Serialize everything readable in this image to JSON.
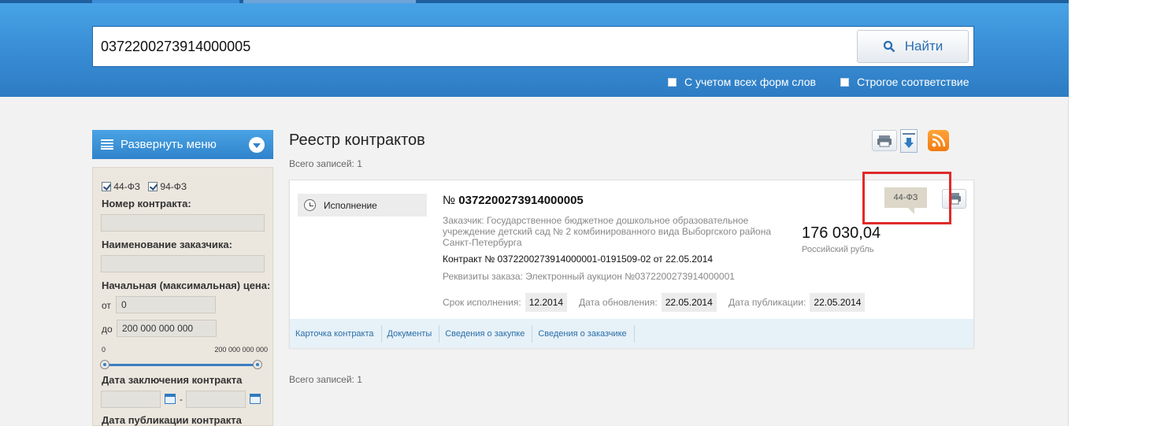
{
  "search": {
    "query": "0372200273914000005",
    "button_label": "Найти",
    "option_all_forms": "С учетом всех форм слов",
    "option_strict": "Строгое соответствие"
  },
  "sidebar": {
    "menu_label": "Развернуть меню",
    "law_44": "44-ФЗ",
    "law_94": "94-ФЗ",
    "contract_number_label": "Номер контракта:",
    "customer_name_label": "Наименование заказчика:",
    "price_label": "Начальная (максимальная) цена:",
    "from_label": "от",
    "from_value": "0",
    "to_label": "до",
    "to_value": "200 000 000 000",
    "slider_min": "0",
    "slider_max": "200 000 000 000",
    "conclusion_date_label": "Дата заключения контракта",
    "date_separator": "-",
    "publication_date_label": "Дата публикации контракта"
  },
  "main": {
    "title": "Реестр контрактов",
    "total_top": "Всего записей: 1",
    "total_bottom": "Всего записей: 1"
  },
  "contract": {
    "status": "Исполнение",
    "number_prefix": "№",
    "number": "0372200273914000005",
    "customer_line1": "Заказчик: Государственное бюджетное дошкольное образовательное",
    "customer_line2": "учреждение детский сад № 2 комбинированного вида Выборгского района",
    "customer_line3": "Санкт-Петербурга",
    "contract_line": "Контракт № 0372200273914000001-0191509-02 от 22.05.2014",
    "order_details": "Реквизиты заказа: Электронный аукцион №0372200273914000001",
    "price": "176 030,04",
    "currency": "Российский рубль",
    "law_tag": "44-ФЗ",
    "exec_label": "Срок исполнения:",
    "exec_value": "12.2014",
    "update_label": "Дата обновления:",
    "update_value": "22.05.2014",
    "pub_label": "Дата публикации:",
    "pub_value": "22.05.2014",
    "links": [
      "Карточка контракта",
      "Документы",
      "Сведения о закупке",
      "Сведения о заказчике"
    ]
  },
  "colors": {
    "banner": "#3a8fd6",
    "highlight": "#e02a2a",
    "link": "#2c6ea8"
  }
}
